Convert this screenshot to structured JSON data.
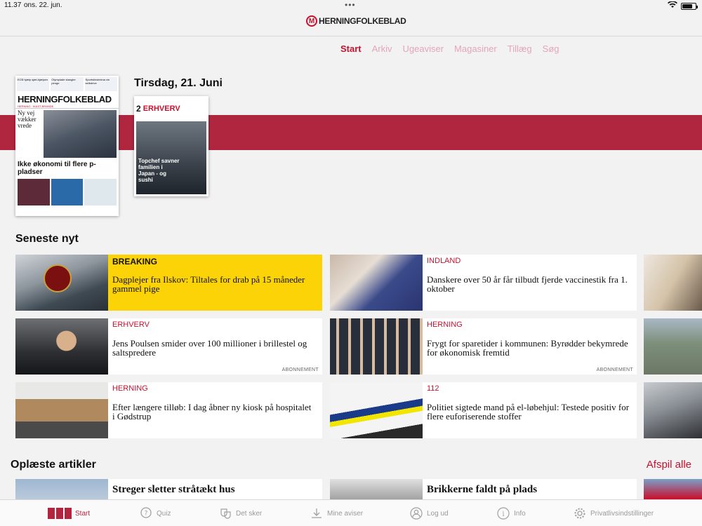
{
  "status": {
    "time": "11.37",
    "date": "ons. 22. jun.",
    "battery_pct": 80
  },
  "header": {
    "logo_mark": "M",
    "logo_text": "HERNINGFOLKEBLAD"
  },
  "nav": {
    "tabs": [
      "Start",
      "Arkiv",
      "Ugeaviser",
      "Magasiner",
      "Tillæg",
      "Søg"
    ],
    "active": "Start"
  },
  "colors": {
    "brand": "#c8102e",
    "band": "#b0263f",
    "breaking": "#fcd307"
  },
  "edition": {
    "date": "Tirsdag, 21. Juni",
    "main_paper": {
      "strip": [
        "ECB hjælp sjæl-hjælpen",
        "Olympiade stangler penge",
        "Sportslinsimima vin selbdrive"
      ],
      "masthead": "HERNINGFOLKEBLAD",
      "sub": "HERNING · IKAST-BRANDE",
      "lead": "Ny vej vækker vrede",
      "headline": "Ikke økonomi til flere p-pladser"
    },
    "section_paper": {
      "number": "2",
      "label": "ERHVERV",
      "caption": "Topchef savner familien i Japan - og sushi"
    }
  },
  "latest": {
    "title": "Seneste nyt",
    "cards": [
      {
        "category": "BREAKING",
        "headline": "Dagplejer fra Ilskov: Tiltales for drab på 15 måneder gammel pige",
        "subscription": "",
        "image": "court-building"
      },
      {
        "category": "INDLAND",
        "headline": "Danskere over 50 år får tilbudt fjerde vaccinestik fra 1. oktober",
        "subscription": "",
        "image": "vaccination"
      },
      {
        "category": "ERHVERV",
        "headline": "Jens Poulsen smider over 100 millioner i brillestel og saltspredere",
        "subscription": "ABONNEMENT",
        "image": "portrait-man"
      },
      {
        "category": "HERNING",
        "headline": "Frygt for sparetider i kommunen: Byrødder bekymrede for økonomisk fremtid",
        "subscription": "ABONNEMENT",
        "image": "group-photo"
      },
      {
        "category": "HERNING",
        "headline": "Efter længere tilløb: I dag åbner ny kiosk på hospitalet i Gødstrup",
        "subscription": "",
        "image": "hospital-interior"
      },
      {
        "category": "112",
        "headline": "Politiet sigtede mand på el-løbehjul: Testede positiv for flere euforiserende stoffer",
        "subscription": "",
        "image": "police-car"
      }
    ]
  },
  "read_articles": {
    "title": "Oplæste artikler",
    "play_all": "Afspil alle",
    "cards": [
      {
        "headline": "Streger sletter stråtækt hus"
      },
      {
        "headline": "Brikkerne faldt på plads"
      }
    ]
  },
  "tabbar": [
    {
      "label": "Start",
      "icon": "newspaper-icon"
    },
    {
      "label": "Quiz",
      "icon": "quiz-icon"
    },
    {
      "label": "Det sker",
      "icon": "masks-icon"
    },
    {
      "label": "Mine aviser",
      "icon": "download-icon"
    },
    {
      "label": "Log ud",
      "icon": "user-icon"
    },
    {
      "label": "Info",
      "icon": "info-icon"
    },
    {
      "label": "Privatlivsindstillinger",
      "icon": "gear-icon"
    }
  ]
}
